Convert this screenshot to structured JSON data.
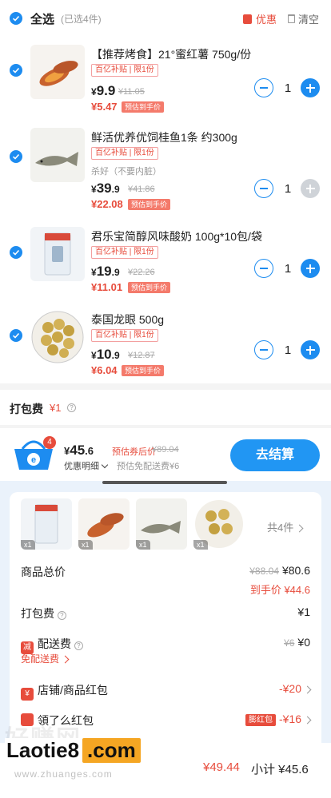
{
  "header": {
    "select_all": "全选",
    "selected_count": "(已选4件)",
    "promo": "优惠",
    "clear": "清空"
  },
  "items": [
    {
      "title": "【推荐烤食】21°蜜红薯 750g/份",
      "badge": "百亿补贴 | 限1份",
      "variant": "",
      "price_int": "9.9",
      "price_dec": "",
      "orig_price": "¥11.05",
      "final_price": "¥5.47",
      "final_tag": "预估到手价",
      "qty": "1"
    },
    {
      "title": "鲜活优养优饲桂鱼1条 约300g",
      "badge": "百亿补贴 | 限1份",
      "variant": "杀好（不要内脏）",
      "price_int": "39",
      "price_dec": ".9",
      "orig_price": "¥41.86",
      "final_price": "¥22.08",
      "final_tag": "预估到手价",
      "qty": "1"
    },
    {
      "title": "君乐宝简醇风味酸奶 100g*10包/袋",
      "badge": "百亿补贴 | 限1份",
      "variant": "",
      "price_int": "19",
      "price_dec": ".9",
      "orig_price": "¥22.26",
      "final_price": "¥11.01",
      "final_tag": "预估到手价",
      "qty": "1"
    },
    {
      "title": "泰国龙眼 500g",
      "badge": "百亿补贴 | 限1份",
      "variant": "",
      "price_int": "10",
      "price_dec": ".9",
      "orig_price": "¥12.87",
      "final_price": "¥6.04",
      "final_tag": "预估到手价",
      "qty": "1"
    }
  ],
  "currency": "¥",
  "packing": {
    "label": "打包费",
    "amount": "¥1"
  },
  "checkout": {
    "cart_count": "4",
    "total_int": "45",
    "total_dec": ".6",
    "estimate_label": "预估券后价",
    "total_orig": "¥89.04",
    "detail_link": "优惠明细",
    "est_fee": "预估免配送费¥6",
    "pay_button": "去结算"
  },
  "sheet": {
    "thumb_qty": "x1",
    "count_all": "共4件",
    "goods_total_label": "商品总价",
    "goods_total_orig": "¥88.04",
    "goods_total": "¥80.6",
    "final_label": "到手价",
    "final_value": "¥44.6",
    "packing_label": "打包费",
    "packing_value": "¥1",
    "delivery_icon": "减",
    "delivery_label": "配送费",
    "delivery_orig": "¥6",
    "delivery_value": "¥0",
    "free_delivery_link": "免配送费",
    "shop_icon": "¥",
    "shop_label": "店铺/商品红包",
    "shop_value": "-¥20",
    "coupon_label": "領了么红包",
    "coupon_tag": "膨红包",
    "coupon_value": "-¥16",
    "subtotal_saved": "¥49.44",
    "subtotal": "小计 ¥45.6"
  },
  "watermark": {
    "big_text": "好赚网",
    "logo_left": "Laotie8",
    "logo_right": ".com",
    "url": "www.zhuanges.com"
  },
  "colors": {
    "accent": "#1d8cf0",
    "price_red": "#e74c3c",
    "pay_button": "#2196f3"
  }
}
